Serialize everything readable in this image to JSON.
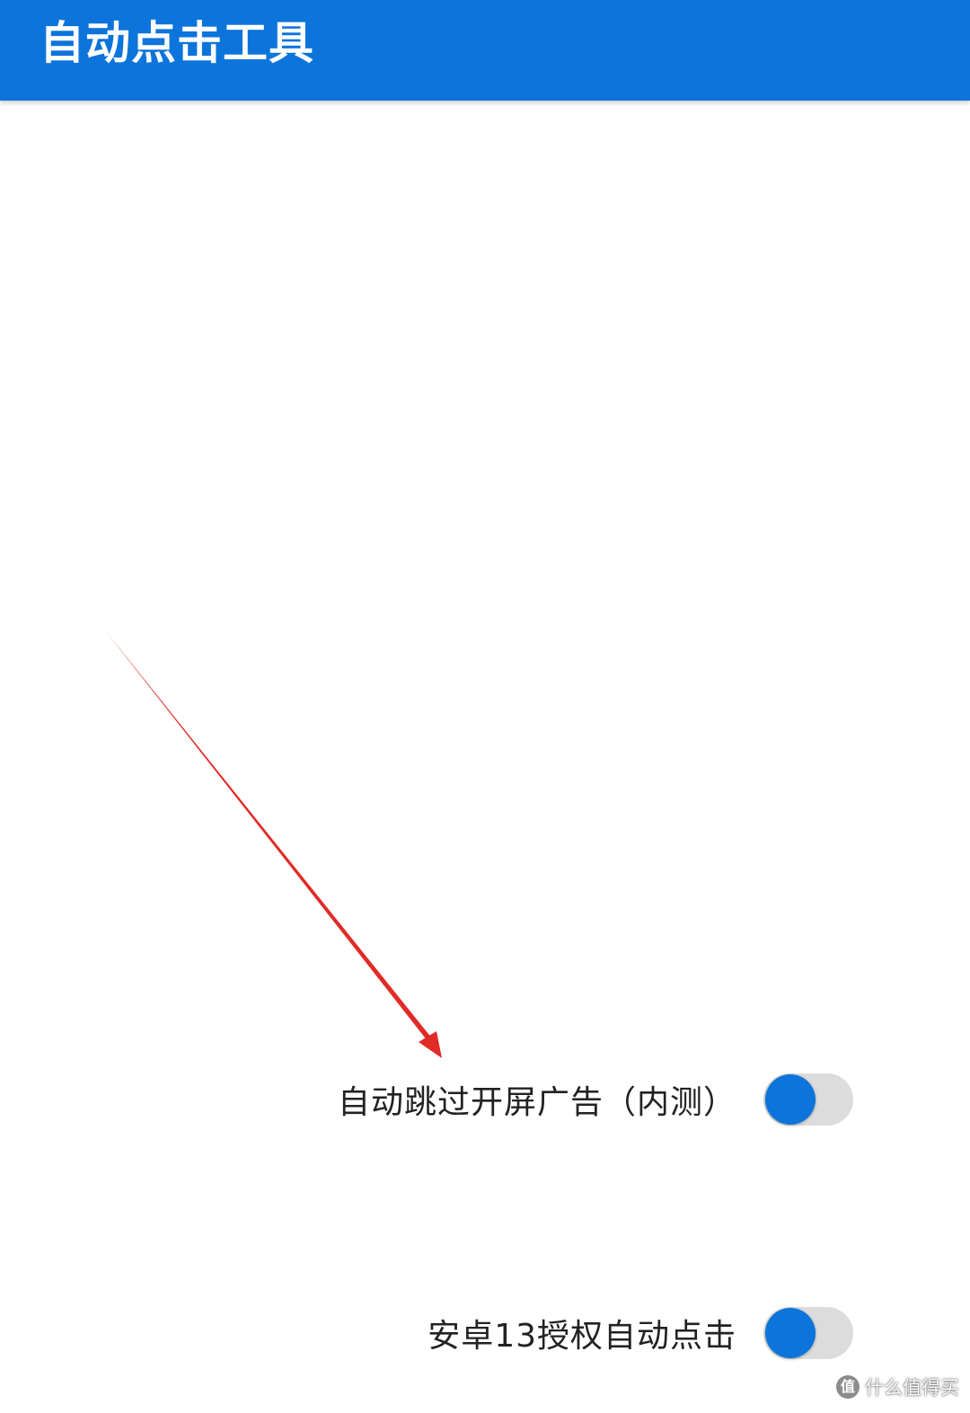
{
  "app_bar": {
    "title": "自动点击工具",
    "color": "#0c74db"
  },
  "settings": [
    {
      "label": "自动跳过开屏广告（内测）",
      "enabled": true
    },
    {
      "label": "安卓13授权自动点击",
      "enabled": true
    }
  ],
  "watermark": {
    "icon": "值",
    "text": "什么值得买"
  },
  "annotation": {
    "arrow_color": "#e02b27"
  }
}
